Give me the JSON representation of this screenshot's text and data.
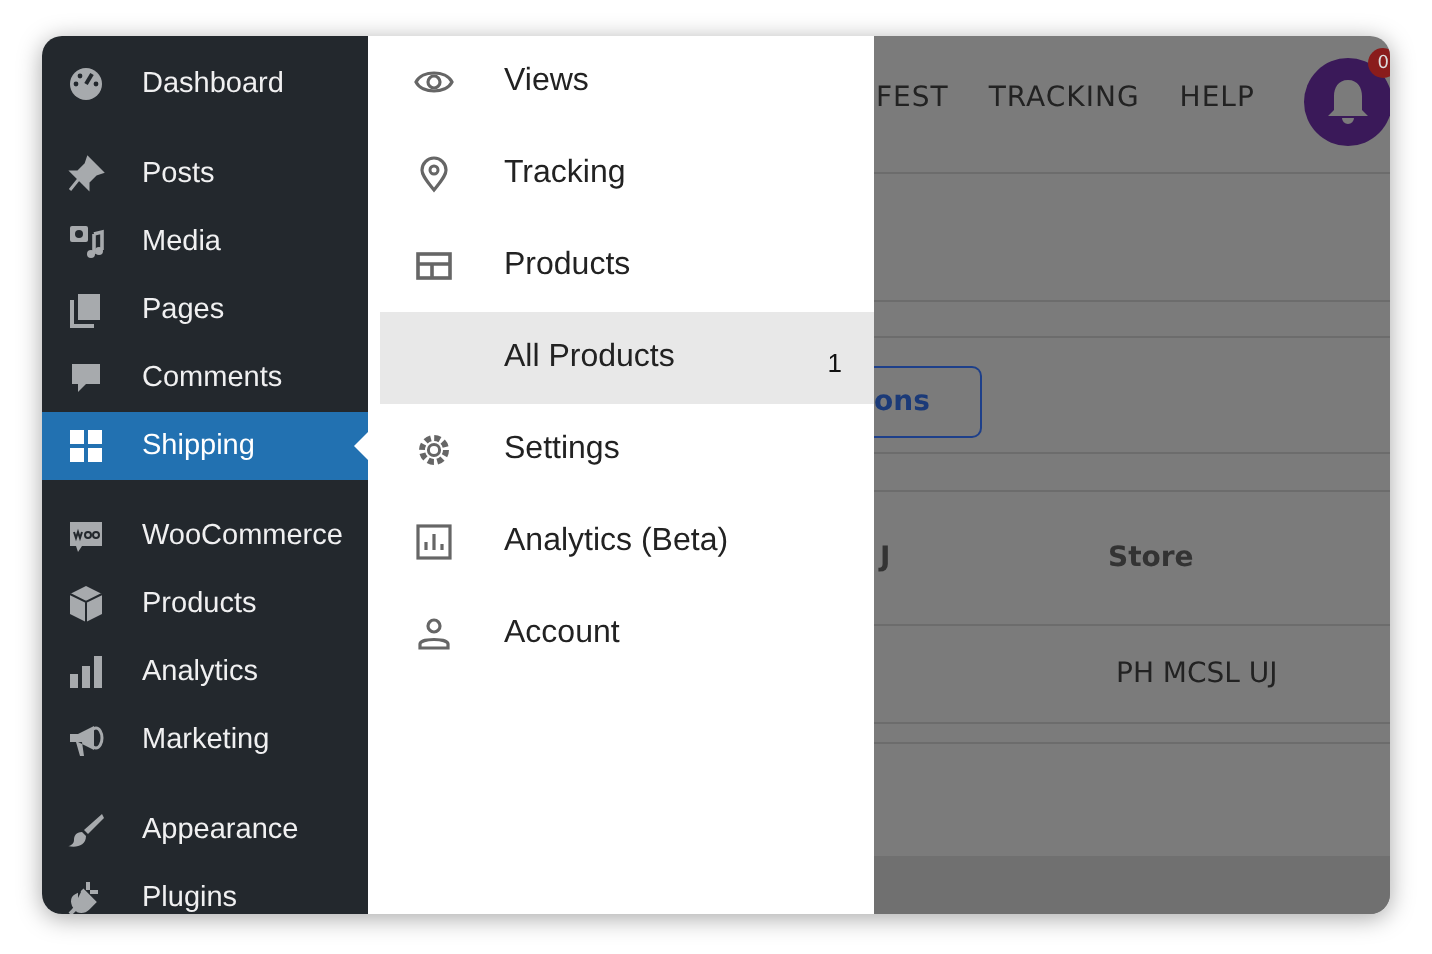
{
  "sidebar": {
    "groups": [
      {
        "items": [
          {
            "label": "Dashboard",
            "selected": false
          }
        ]
      },
      {
        "items": [
          {
            "label": "Posts",
            "selected": false
          },
          {
            "label": "Media",
            "selected": false
          },
          {
            "label": "Pages",
            "selected": false
          },
          {
            "label": "Comments",
            "selected": false
          },
          {
            "label": "Shipping",
            "selected": true
          }
        ]
      },
      {
        "items": [
          {
            "label": "WooCommerce",
            "selected": false
          },
          {
            "label": "Products",
            "selected": false
          },
          {
            "label": "Analytics",
            "selected": false
          },
          {
            "label": "Marketing",
            "selected": false
          }
        ]
      },
      {
        "items": [
          {
            "label": "Appearance",
            "selected": false
          },
          {
            "label": "Plugins",
            "selected": false
          }
        ]
      }
    ]
  },
  "flyout": {
    "items": [
      {
        "label": "Views",
        "selected": false
      },
      {
        "label": "Tracking",
        "selected": false
      },
      {
        "label": "Products",
        "selected": false
      },
      {
        "label": "All Products",
        "selected": true,
        "count": "1"
      },
      {
        "label": "Settings",
        "selected": false
      },
      {
        "label": "Analytics (Beta)",
        "selected": false
      },
      {
        "label": "Account",
        "selected": false
      }
    ]
  },
  "content": {
    "nav": [
      "FEST",
      "TRACKING",
      "HELP"
    ],
    "notification_count": "0",
    "button": "ons",
    "table": {
      "columns": [
        "J",
        "Store"
      ],
      "rows": [
        {
          "store": "PH MCSL UJ"
        }
      ]
    }
  }
}
